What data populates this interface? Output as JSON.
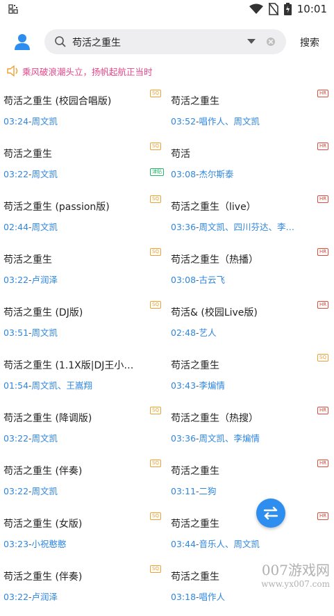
{
  "statusbar": {
    "time": "10:01"
  },
  "header": {
    "search_text": "苟活之重生",
    "search_button": "搜索"
  },
  "notice": {
    "text": "乘风破浪潮头立，扬帆起航正当时"
  },
  "songs": [
    {
      "title": "苟活之重生 (校园合唱版)",
      "duration": "03:24",
      "artist": "周文凯",
      "badge": "SQ"
    },
    {
      "title": "苟活之重生",
      "duration": "03:52",
      "artist": "唱作人、周文凯",
      "badge": "HR"
    },
    {
      "title": "苟活之重生",
      "duration": "03:22",
      "artist": "周文凯",
      "badge": "SQ",
      "badge2": "津贴"
    },
    {
      "title": "苟活",
      "duration": "03:08",
      "artist": "杰尔斯泰",
      "badge": "HR"
    },
    {
      "title": "苟活之重生 (passion版)",
      "duration": "02:44",
      "artist": "周文凯",
      "badge": "SQ"
    },
    {
      "title": "苟活之重生（live）",
      "duration": "03:36",
      "artist": "周文凯、四川芬达、李…",
      "badge": "HR"
    },
    {
      "title": "苟活之重生",
      "duration": "03:22",
      "artist": "卢润泽",
      "badge": "SQ"
    },
    {
      "title": "苟活之重生（热播）",
      "duration": "03:08",
      "artist": "古云飞",
      "badge": "HR"
    },
    {
      "title": "苟活之重生 (DJ版)",
      "duration": "03:51",
      "artist": "周文凯",
      "badge": "SQ"
    },
    {
      "title": "苟活& (校园Live版)",
      "duration": "02:48",
      "artist": "艺人",
      "badge": "HR"
    },
    {
      "title": " 苟活之重生 (1.1X版|DJ王小…",
      "duration": "01:54",
      "artist": "周文凯、王嵩翔",
      "badge": ""
    },
    {
      "title": "苟活之重生",
      "duration": "03:43",
      "artist": "李煸情",
      "badge": "SQ"
    },
    {
      "title": "苟活之重生 (降调版)",
      "duration": "03:22",
      "artist": "周文凯",
      "badge": "SQ"
    },
    {
      "title": "苟活之重生（热搜）",
      "duration": "03:36",
      "artist": "周文凯、李煸情",
      "badge": "HR"
    },
    {
      "title": "苟活之重生 (伴奏)",
      "duration": "03:22",
      "artist": "周文凯",
      "badge": "SQ"
    },
    {
      "title": "苟活之重生",
      "duration": "03:11",
      "artist": "二狗",
      "badge": "HR"
    },
    {
      "title": "苟活之重生 (女版)",
      "duration": "03:23",
      "artist": "小祝憨憨",
      "badge": "SQ"
    },
    {
      "title": "苟活之重生",
      "duration": "03:44",
      "artist": "音乐人、周文凯",
      "badge": "HR"
    },
    {
      "title": "苟活之重生 (伴奏)",
      "duration": "03:22",
      "artist": "卢润泽",
      "badge": "SQ"
    },
    {
      "title": "苟活之重生",
      "duration": "03:18",
      "artist": "唱作人",
      "badge": ""
    }
  ],
  "watermark": {
    "line1": "007游戏网",
    "line2": "www.yx007.com"
  },
  "colors": {
    "accent": "#2e86e0",
    "notice": "#e6458a",
    "sq": "#f0a030",
    "hr": "#e04a3a",
    "fab": "#2e8ef0"
  }
}
